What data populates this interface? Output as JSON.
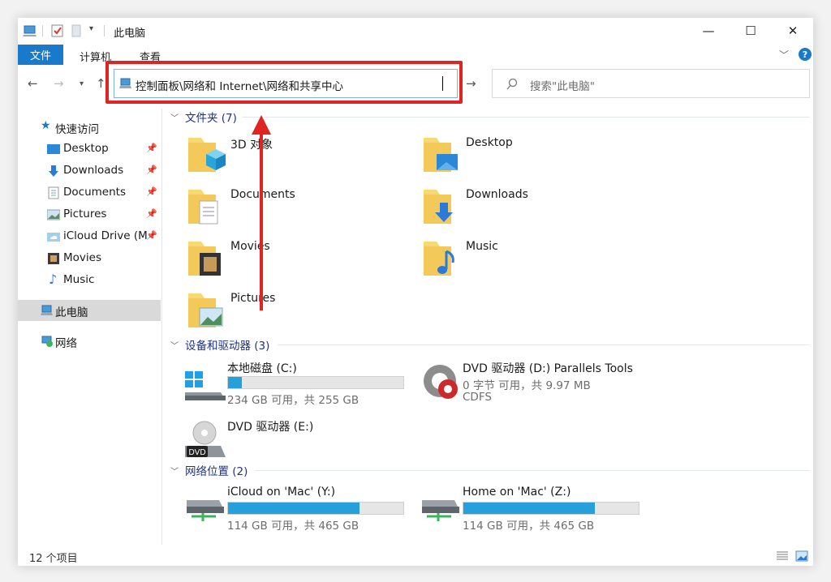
{
  "window": {
    "title": "此电脑"
  },
  "ribbon": {
    "tab_file": "文件",
    "tab_computer": "计算机",
    "tab_view": "查看",
    "help": "?"
  },
  "address": {
    "path": "控制面板\\网络和 Internet\\网络和共享中心"
  },
  "search": {
    "placeholder": "搜索\"此电脑\""
  },
  "sidebar": {
    "quick_access": "快速访问",
    "items": [
      {
        "label": "Desktop",
        "pinned": true,
        "icon": "desktop-icon"
      },
      {
        "label": "Downloads",
        "pinned": true,
        "icon": "download-icon"
      },
      {
        "label": "Documents",
        "pinned": true,
        "icon": "document-icon"
      },
      {
        "label": "Pictures",
        "pinned": true,
        "icon": "picture-icon"
      },
      {
        "label": "iCloud Drive (M",
        "pinned": true,
        "icon": "icloud-folder-icon"
      },
      {
        "label": "Movies",
        "pinned": false,
        "icon": "film-icon"
      },
      {
        "label": "Music",
        "pinned": false,
        "icon": "music-note-icon"
      }
    ],
    "this_pc": "此电脑",
    "network": "网络"
  },
  "groups": {
    "folders": {
      "title": "文件夹 (7)"
    },
    "devices": {
      "title": "设备和驱动器 (3)"
    },
    "network": {
      "title": "网络位置 (2)"
    }
  },
  "folders": [
    {
      "name": "3D 对象"
    },
    {
      "name": "Desktop"
    },
    {
      "name": "Documents"
    },
    {
      "name": "Downloads"
    },
    {
      "name": "Movies"
    },
    {
      "name": "Music"
    },
    {
      "name": "Pictures"
    }
  ],
  "drives": {
    "c": {
      "name": "本地磁盘 (C:)",
      "free": "234 GB 可用，共 255 GB",
      "used_fraction": 0.08
    },
    "d": {
      "name": "DVD 驱动器 (D:) Parallels Tools",
      "free": "0 字节 可用，共 9.97 MB",
      "fs": "CDFS"
    },
    "e": {
      "name": "DVD 驱动器 (E:)",
      "icon_label": "DVD"
    },
    "y": {
      "name": "iCloud on 'Mac' (Y:)",
      "free": "114 GB 可用，共 465 GB",
      "used_fraction": 0.75
    },
    "z": {
      "name": "Home on 'Mac' (Z:)",
      "free": "114 GB 可用，共 465 GB",
      "used_fraction": 0.75
    }
  },
  "status": {
    "count": "12 个项目"
  },
  "colors": {
    "accent": "#1979ca",
    "highlight": "#e02424",
    "bar_fill": "#26a0da",
    "folder": "#f8d775"
  }
}
